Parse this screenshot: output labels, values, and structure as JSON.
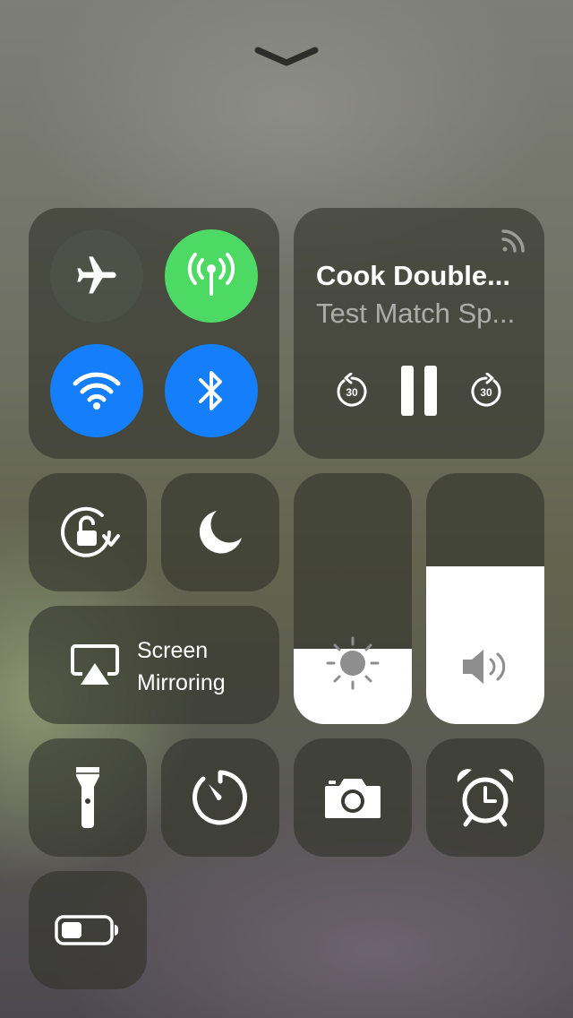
{
  "grabber": {
    "icon": "chevron-down-icon"
  },
  "connectivity": {
    "airplane": {
      "icon": "airplane-icon",
      "on": false
    },
    "cellular": {
      "icon": "cellular-data-icon",
      "on": true,
      "color": "#4cd964"
    },
    "wifi": {
      "icon": "wifi-icon",
      "on": true,
      "color": "#147efb"
    },
    "bluetooth": {
      "icon": "bluetooth-icon",
      "on": true,
      "color": "#147efb"
    }
  },
  "now_playing": {
    "title": "Cook Double...",
    "subtitle": "Test Match Sp...",
    "airplay_icon": "airplay-audio-icon",
    "skip_back": {
      "icon": "skip-back-30-icon",
      "seconds": "30"
    },
    "play_pause": {
      "icon": "pause-icon"
    },
    "skip_forward": {
      "icon": "skip-forward-30-icon",
      "seconds": "30"
    }
  },
  "rotation_lock": {
    "icon": "rotation-lock-icon"
  },
  "do_not_disturb": {
    "icon": "moon-icon"
  },
  "screen_mirroring": {
    "line1": "Screen",
    "line2": "Mirroring",
    "icon": "screen-mirroring-icon"
  },
  "brightness": {
    "icon": "sun-icon",
    "level": 0.3
  },
  "volume": {
    "icon": "speaker-icon",
    "level": 0.63
  },
  "shortcuts": [
    {
      "icon": "flashlight-icon"
    },
    {
      "icon": "timer-icon"
    },
    {
      "icon": "camera-icon"
    },
    {
      "icon": "alarm-clock-icon"
    }
  ],
  "low_power": {
    "icon": "battery-icon"
  }
}
